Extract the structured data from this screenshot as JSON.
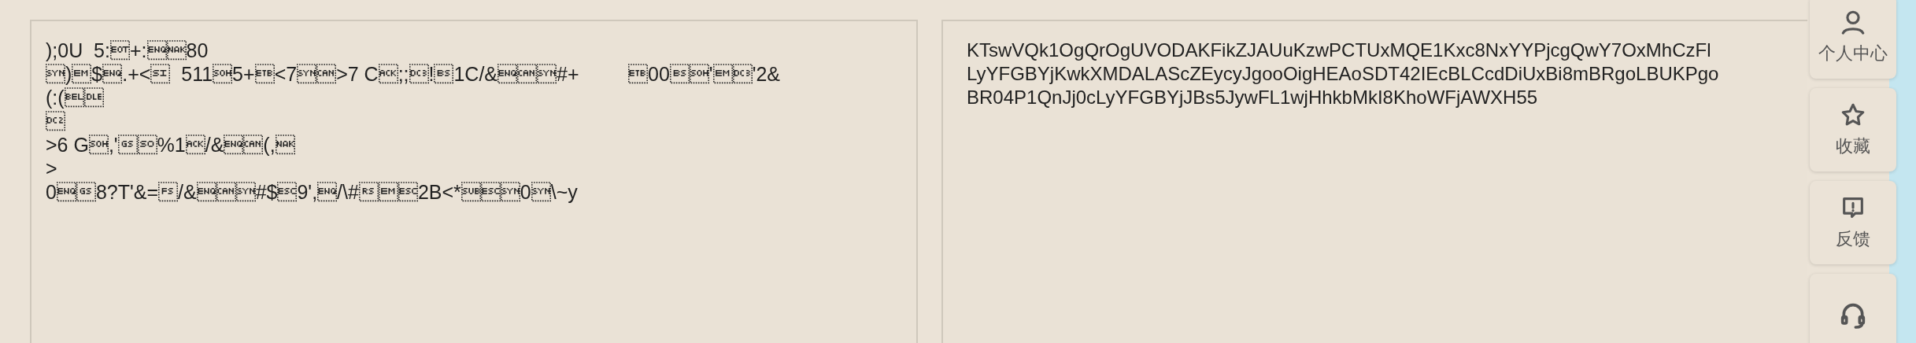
{
  "input_text": {
    "lines": [
      ");0U  5:\u0004+:\u0005\u001580",
      "\u0016)\u0019$\u0005.+<\u000f  511\u00015+\u0017<7\u0016\u0018>7 C\u0006;;\u0013!\b1C/&\u0005\u0018\u0016#+         \u001700\b\u0001'\u0019\u0013'2&",
      "(:(\u0007\u0010",
      "\u0012",
      ">6 G\u0001,'\u001d\u000e%1\u0006/&\u0005\u0018(,\u0015",
      ">",
      "0\u0005\u001d8?T'&=\u001c/&\u0005\u0018\u0016#$\u001b9',\u0005/\\#\u001e\u0019\u001b2B<*\u001a\u001b\u00160\u0016\\~y"
    ]
  },
  "output_text": {
    "lines": [
      "KTswVQk1OgQrOgUVODAKFikZJAUuKzwPCTUxMQE1Kxc8NxYYPjcgQwY7OxMhCzFl",
      "LyYFGBYjKwkXMDALAScZEycyJgooOigHEAoSDT42IEcBLCcdDiUxBi8mBRgoLBUKPgo",
      "BR04P1QnJj0cLyYFGBYjJBs5JywFL1wjHhkbMkI8KhoWFjAWXH55"
    ]
  },
  "side_buttons": [
    {
      "kind": "user",
      "label": "个人中心"
    },
    {
      "kind": "star",
      "label": "收藏"
    },
    {
      "kind": "feedback",
      "label": "反馈"
    },
    {
      "kind": "headset"
    }
  ]
}
